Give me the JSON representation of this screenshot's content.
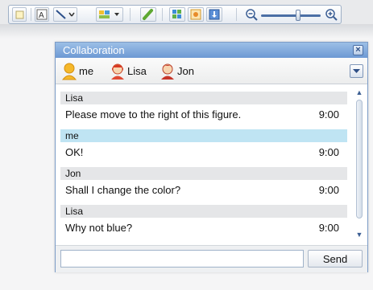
{
  "toolbar": {
    "tools": [
      "select-tool",
      "text-tool",
      "line-tool",
      "shape-tool",
      "pen-tool",
      "grid-tool",
      "image-tool",
      "download-tool"
    ],
    "zoom": {
      "out_icon": "zoom-out-icon",
      "in_icon": "zoom-in-icon"
    }
  },
  "collab": {
    "title": "Collaboration",
    "close_label": "×",
    "participants": [
      {
        "name": "me",
        "icon": "user-icon",
        "color": "#f2b01e"
      },
      {
        "name": "Lisa",
        "icon": "user-icon",
        "color": "#e0442f"
      },
      {
        "name": "Jon",
        "icon": "user-icon",
        "color": "#c7362a"
      }
    ],
    "messages": [
      {
        "sender": "Lisa",
        "text": "Please move to the right of this figure.",
        "time": "9:00",
        "own": false
      },
      {
        "sender": "me",
        "text": "OK!",
        "time": "9:00",
        "own": true
      },
      {
        "sender": "Jon",
        "text": "Shall I change the color?",
        "time": "9:00",
        "own": false
      },
      {
        "sender": "Lisa",
        "text": "Why not blue?",
        "time": "9:00",
        "own": false
      }
    ],
    "input": {
      "value": "",
      "placeholder": ""
    },
    "send_label": "Send"
  },
  "colors": {
    "accent": "#6d99d4",
    "own_message": "#bfe4f3",
    "other_message": "#e5e6e8"
  }
}
